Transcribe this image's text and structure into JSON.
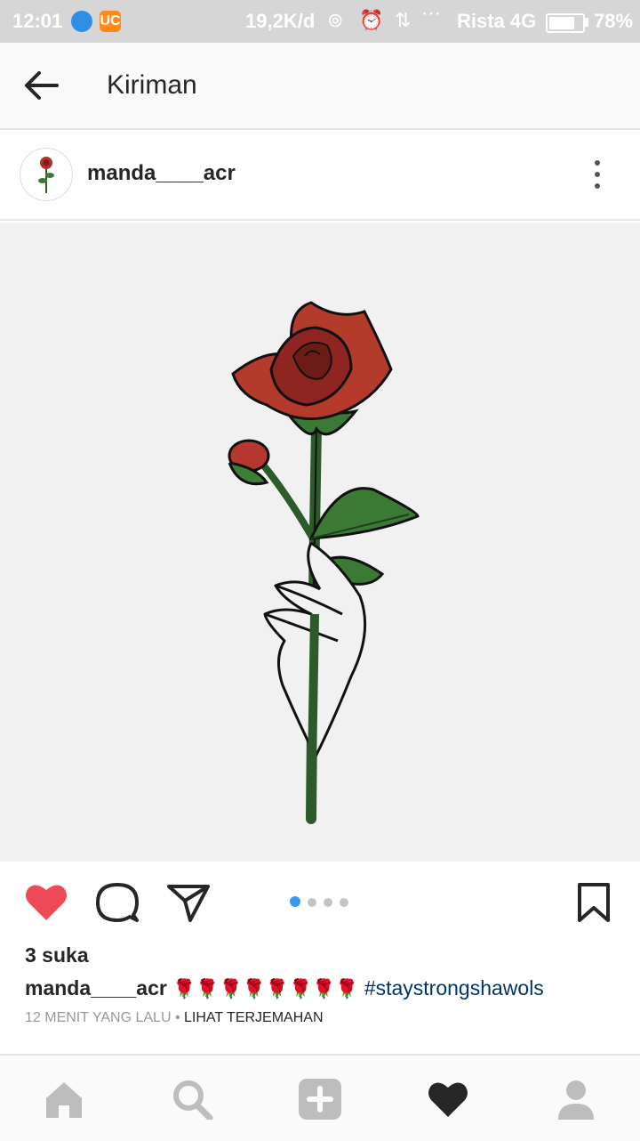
{
  "status_bar": {
    "time": "12:01",
    "speed": "19,2K/d",
    "carrier": "Rista 4G",
    "battery": "78%",
    "app2_glyph": "UC"
  },
  "header": {
    "title": "Kiriman",
    "back_icon": "arrow-left-icon"
  },
  "post": {
    "username": "manda____acr",
    "more_icon": "more-vertical-icon",
    "image_subject": "rose-held-in-hand-illustration",
    "likes": "3 suka",
    "caption_user": "manda____acr",
    "caption_emoji": "🌹🌹🌹🌹🌹🌹🌹🌹",
    "caption_tag": "#staystrongshawols",
    "time_ago": "12 MENIT YANG LALU",
    "separator": " • ",
    "translate": "LIHAT TERJEMAHAN",
    "carousel_count": 4,
    "carousel_active": 0
  },
  "actions": [
    "like-heart-icon",
    "comment-icon",
    "share-icon",
    "bookmark-icon"
  ],
  "bottom_nav": [
    "home-icon",
    "search-icon",
    "add-post-icon",
    "activity-heart-icon",
    "profile-icon"
  ],
  "colors": {
    "like_red": "#ed4956",
    "link_blue": "#003569",
    "active_dot": "#3897f0",
    "statusbar_bg": "#d6d6d6"
  }
}
